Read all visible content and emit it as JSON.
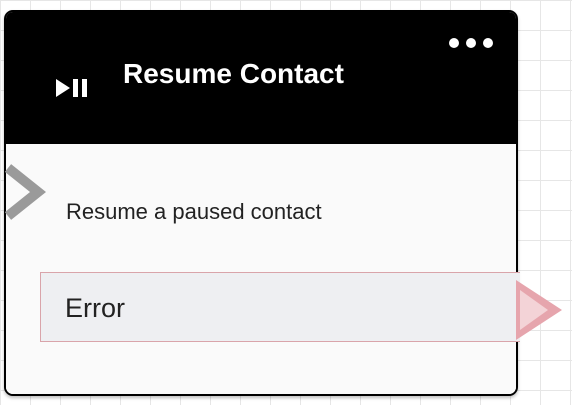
{
  "block": {
    "title": "Resume Contact",
    "icon": "play-pause-icon",
    "menu_icon": "more-options-icon",
    "description": "Resume a paused contact",
    "branches": [
      {
        "label": "Error",
        "color": "#e6a5ad"
      }
    ],
    "header_color": "#000000",
    "input_connector_color": "#9a9a9a"
  }
}
